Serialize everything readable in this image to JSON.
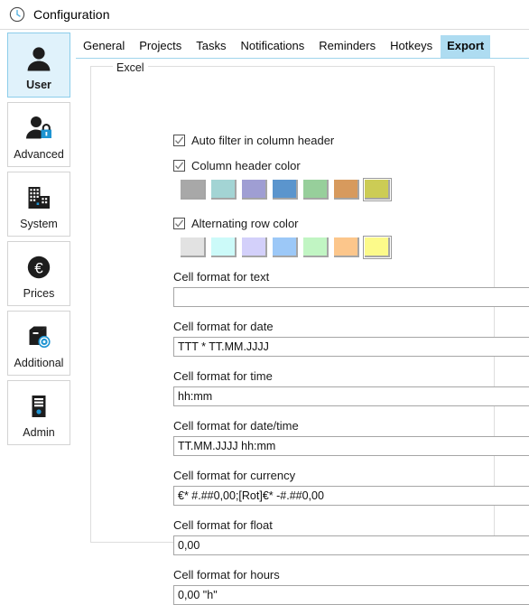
{
  "window": {
    "title": "Configuration",
    "icon": "clock-icon"
  },
  "sidebar": {
    "items": [
      {
        "label": "User",
        "icon": "person-icon",
        "selected": true
      },
      {
        "label": "Advanced",
        "icon": "person-lock-icon",
        "selected": false
      },
      {
        "label": "System",
        "icon": "building-icon",
        "selected": false
      },
      {
        "label": "Prices",
        "icon": "euro-icon",
        "selected": false
      },
      {
        "label": "Additional",
        "icon": "box-disc-icon",
        "selected": false
      },
      {
        "label": "Admin",
        "icon": "server-icon",
        "selected": false
      }
    ]
  },
  "tabs": [
    {
      "label": "General",
      "selected": false
    },
    {
      "label": "Projects",
      "selected": false
    },
    {
      "label": "Tasks",
      "selected": false
    },
    {
      "label": "Notifications",
      "selected": false
    },
    {
      "label": "Reminders",
      "selected": false
    },
    {
      "label": "Hotkeys",
      "selected": false
    },
    {
      "label": "Export",
      "selected": true
    }
  ],
  "group": {
    "legend": "Excel"
  },
  "options": {
    "auto_filter": {
      "label": "Auto filter in column header",
      "checked": true
    },
    "column_header_color": {
      "label": "Column header color",
      "checked": true,
      "swatches": [
        "#a8a8a8",
        "#a3d4d4",
        "#9f9ed3",
        "#5b95cd",
        "#97cf9b",
        "#d79a5d",
        "#cccc55"
      ],
      "selected_index": 6
    },
    "alternating_row_color": {
      "label": "Alternating row color",
      "checked": true,
      "swatches": [
        "#e2e2e2",
        "#ccfaf9",
        "#d3d0fa",
        "#9cc8f7",
        "#c1f5c3",
        "#fcc68b",
        "#fcfa8a"
      ],
      "selected_index": 6
    }
  },
  "fields": [
    {
      "label": "Cell format for text",
      "value": "",
      "placeholder": ""
    },
    {
      "label": "Cell format for date",
      "value": "TTT * TT.MM.JJJJ",
      "placeholder": ""
    },
    {
      "label": "Cell format for time",
      "value": "hh:mm",
      "placeholder": ""
    },
    {
      "label": "Cell format for date/time",
      "value": "TT.MM.JJJJ hh:mm",
      "placeholder": ""
    },
    {
      "label": "Cell format for currency",
      "value": "€* #.##0,00;[Rot]€* -#.##0,00",
      "placeholder": ""
    },
    {
      "label": "Cell format for float",
      "value": "0,00",
      "placeholder": ""
    },
    {
      "label": "Cell format for hours",
      "value": "0,00 \"h\"",
      "placeholder": ""
    }
  ],
  "colors": {
    "accent": "#aedcf1",
    "tab_underline": "#9fd4ec",
    "selected_sidebar_bg": "#e0f2fb",
    "icon_dark": "#1d1d1d",
    "icon_blue": "#1e94d2"
  }
}
